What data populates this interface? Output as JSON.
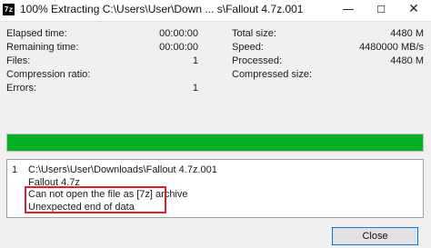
{
  "window": {
    "title": "100% Extracting C:\\Users\\User\\Down ... s\\Fallout 4.7z.001",
    "app_icon": "7z",
    "controls": {
      "minimize": "—",
      "maximize": "☐",
      "close": "✕"
    }
  },
  "stats_left": [
    {
      "label": "Elapsed time:",
      "value": "00:00:00"
    },
    {
      "label": "Remaining time:",
      "value": "00:00:00"
    },
    {
      "label": "Files:",
      "value": "1"
    },
    {
      "label": "Compression ratio:",
      "value": ""
    },
    {
      "label": "Errors:",
      "value": "1"
    }
  ],
  "stats_right": [
    {
      "label": "Total size:",
      "value": "4480 M"
    },
    {
      "label": "Speed:",
      "value": "4480000 MB/s"
    },
    {
      "label": "Processed:",
      "value": "4480 M"
    },
    {
      "label": "Compressed size:",
      "value": ""
    }
  ],
  "progress": {
    "percent": 100,
    "color": "#06b025"
  },
  "log": {
    "index": "1",
    "lines": [
      "C:\\Users\\User\\Downloads\\Fallout 4.7z.001",
      "Fallout 4.7z",
      "Can not open the file as [7z] archive",
      "Unexpected end of data"
    ],
    "highlight_color": "#d9232a"
  },
  "buttons": {
    "close_label": "Close"
  }
}
